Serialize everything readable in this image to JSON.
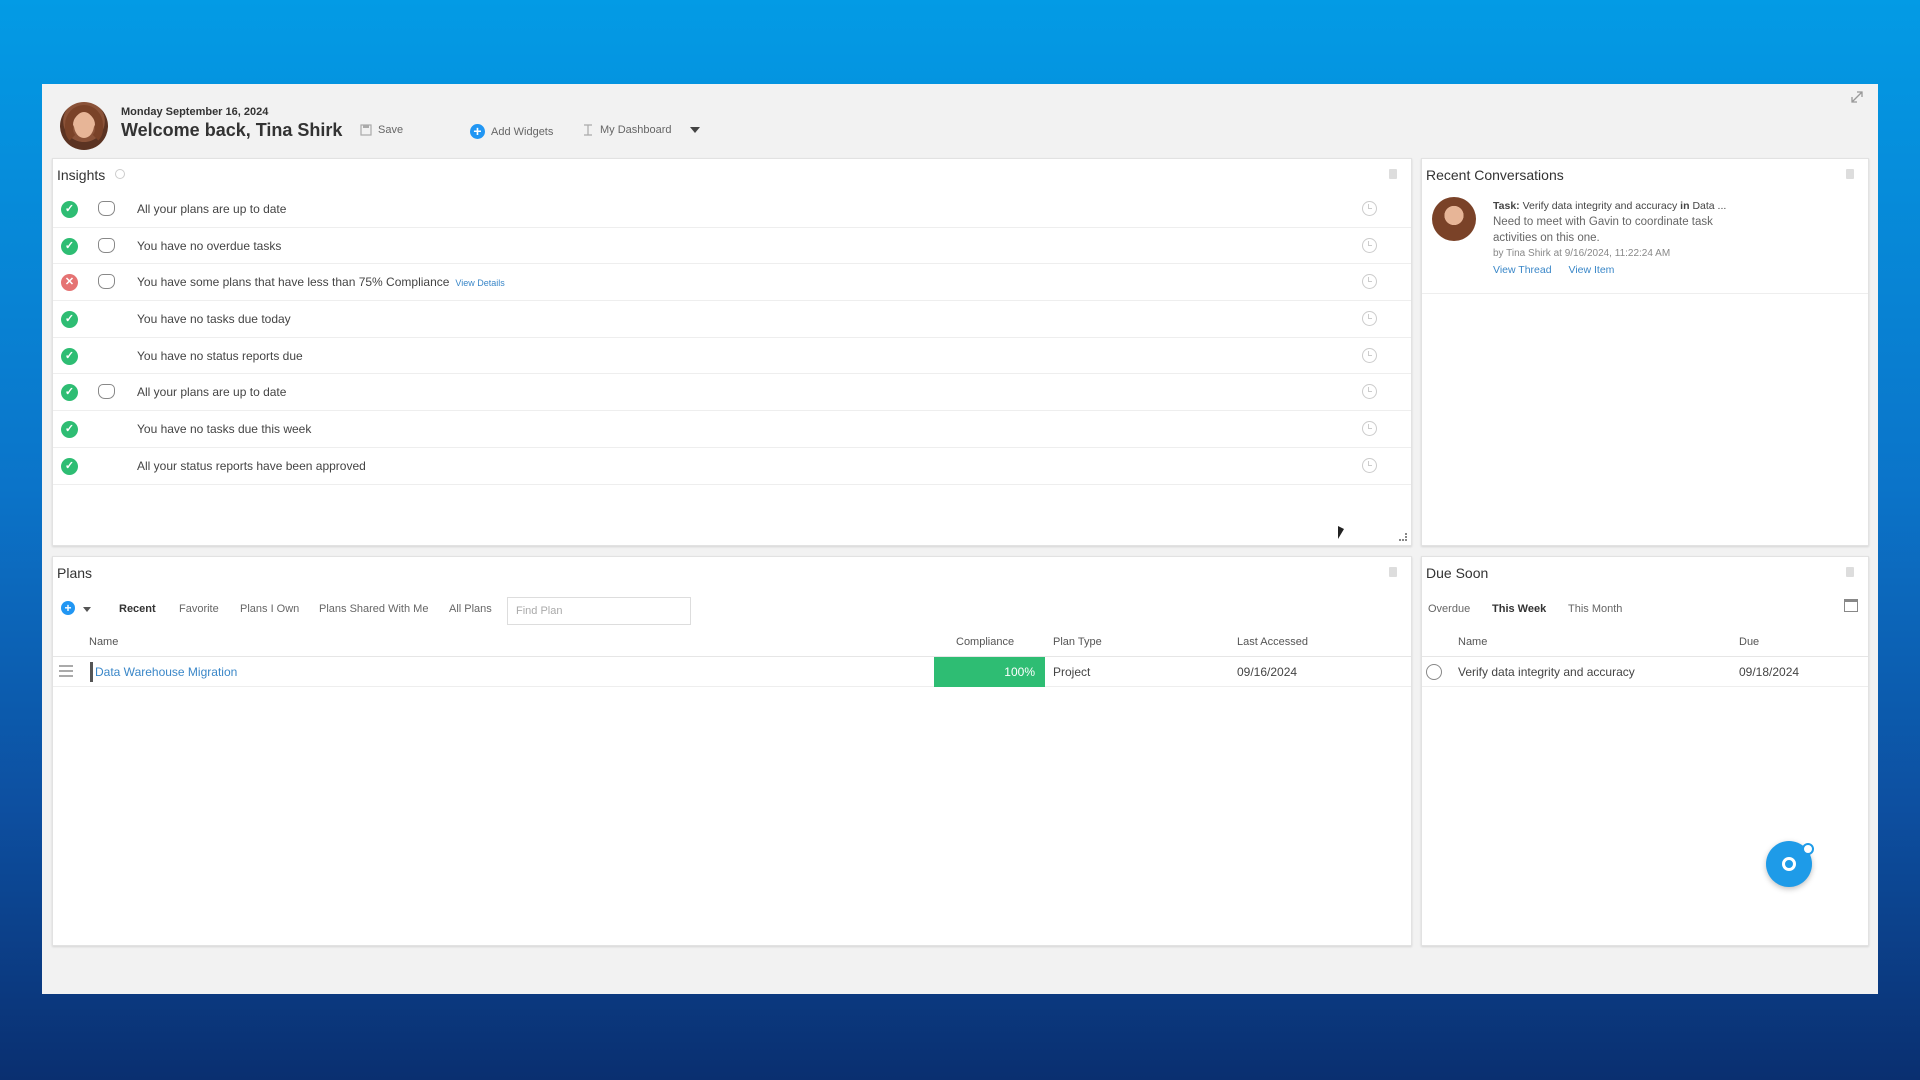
{
  "header": {
    "date": "Monday September 16, 2024",
    "welcome": "Welcome back, Tina Shirk",
    "save_label": "Save",
    "add_widgets_label": "Add Widgets",
    "dashboard_label": "My Dashboard"
  },
  "insights": {
    "title": "Insights",
    "items": [
      {
        "text": "All your plans are up to date",
        "status": "ok",
        "badge": true
      },
      {
        "text": "You have no overdue tasks",
        "status": "ok",
        "badge": true
      },
      {
        "text": "You have some plans that have less than 75% Compliance",
        "status": "bad",
        "badge": true,
        "link": "View Details"
      },
      {
        "text": "You have no tasks due today",
        "status": "ok",
        "badge": false
      },
      {
        "text": "You have no status reports due",
        "status": "ok",
        "badge": false
      },
      {
        "text": "All your plans are up to date",
        "status": "ok",
        "badge": true
      },
      {
        "text": "You have no tasks due this week",
        "status": "ok",
        "badge": false
      },
      {
        "text": "All your status reports have been approved",
        "status": "ok",
        "badge": false
      }
    ]
  },
  "recent": {
    "title": "Recent Conversations",
    "task_prefix": "Task:",
    "task_name": "Verify data integrity and accuracy",
    "task_in": "in",
    "task_plan": "Data ...",
    "message": "Need to meet with Gavin to coordinate task activities on this one.",
    "by": "by Tina Shirk at 9/16/2024, 11:22:24 AM",
    "view_thread": "View Thread",
    "view_item": "View Item"
  },
  "plans": {
    "title": "Plans",
    "tabs": [
      "Recent",
      "Favorite",
      "Plans I Own",
      "Plans Shared With Me",
      "All Plans"
    ],
    "active_tab": 0,
    "search_placeholder": "Find Plan",
    "columns": {
      "name": "Name",
      "compliance": "Compliance",
      "plan_type": "Plan Type",
      "last_accessed": "Last Accessed"
    },
    "rows": [
      {
        "name": "Data Warehouse Migration",
        "compliance": "100%",
        "plan_type": "Project",
        "last_accessed": "09/16/2024"
      }
    ]
  },
  "due": {
    "title": "Due Soon",
    "tabs": [
      "Overdue",
      "This Week",
      "This Month"
    ],
    "active_tab": 1,
    "columns": {
      "name": "Name",
      "due": "Due"
    },
    "rows": [
      {
        "name": "Verify data integrity and accuracy",
        "due": "09/18/2024"
      }
    ]
  },
  "colors": {
    "accent": "#2196f3",
    "success": "#2ebd73",
    "error": "#e57373",
    "link": "#3a87c8"
  }
}
